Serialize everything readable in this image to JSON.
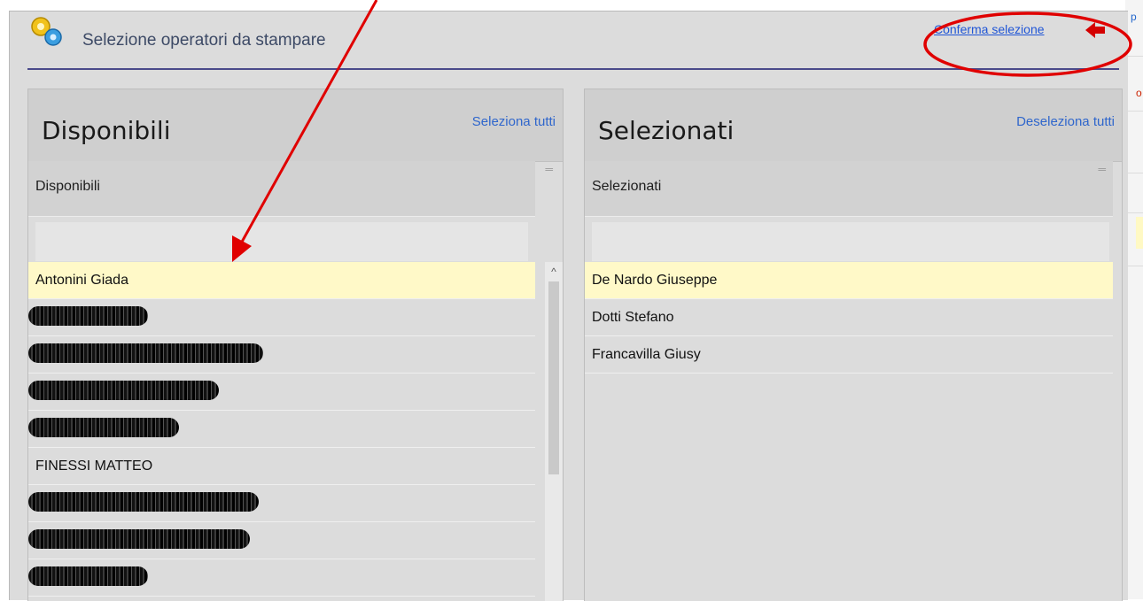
{
  "dialog": {
    "title": "Selezione operatori da stampare",
    "confirm_label": "Conferma selezione"
  },
  "available": {
    "heading": "Disponibili",
    "select_all_label": "Seleziona tutti",
    "column_label": "Disponibili",
    "filter_value": "",
    "items": [
      {
        "label": "Antonini Giada",
        "redacted": false,
        "selected": true
      },
      {
        "label": "",
        "redacted": true,
        "selected": false
      },
      {
        "label": "",
        "redacted": true,
        "selected": false
      },
      {
        "label": "",
        "redacted": true,
        "selected": false
      },
      {
        "label": "",
        "redacted": true,
        "selected": false
      },
      {
        "label": "FINESSI MATTEO",
        "redacted": false,
        "selected": false
      },
      {
        "label": "",
        "redacted": true,
        "selected": false
      },
      {
        "label": "",
        "redacted": true,
        "selected": false
      },
      {
        "label": "",
        "redacted": true,
        "selected": false
      }
    ]
  },
  "selected": {
    "heading": "Selezionati",
    "deselect_all_label": "Deseleziona tutti",
    "column_label": "Selezionati",
    "filter_value": "",
    "items": [
      {
        "label": "De Nardo Giuseppe",
        "selected": true
      },
      {
        "label": "Dotti Stefano",
        "selected": false
      },
      {
        "label": "Francavilla Giusy",
        "selected": false
      }
    ]
  },
  "background_page": {
    "link_fragment": "p",
    "red_fragment": "o"
  },
  "icons": [
    "gears-icon",
    "confirm-arrow-icon",
    "scroll-up-icon"
  ],
  "colors": {
    "link": "#1f55d6",
    "selected_row": "#fff9c8",
    "title_rule": "#4a4a8a",
    "annotation_red": "#e00000"
  }
}
